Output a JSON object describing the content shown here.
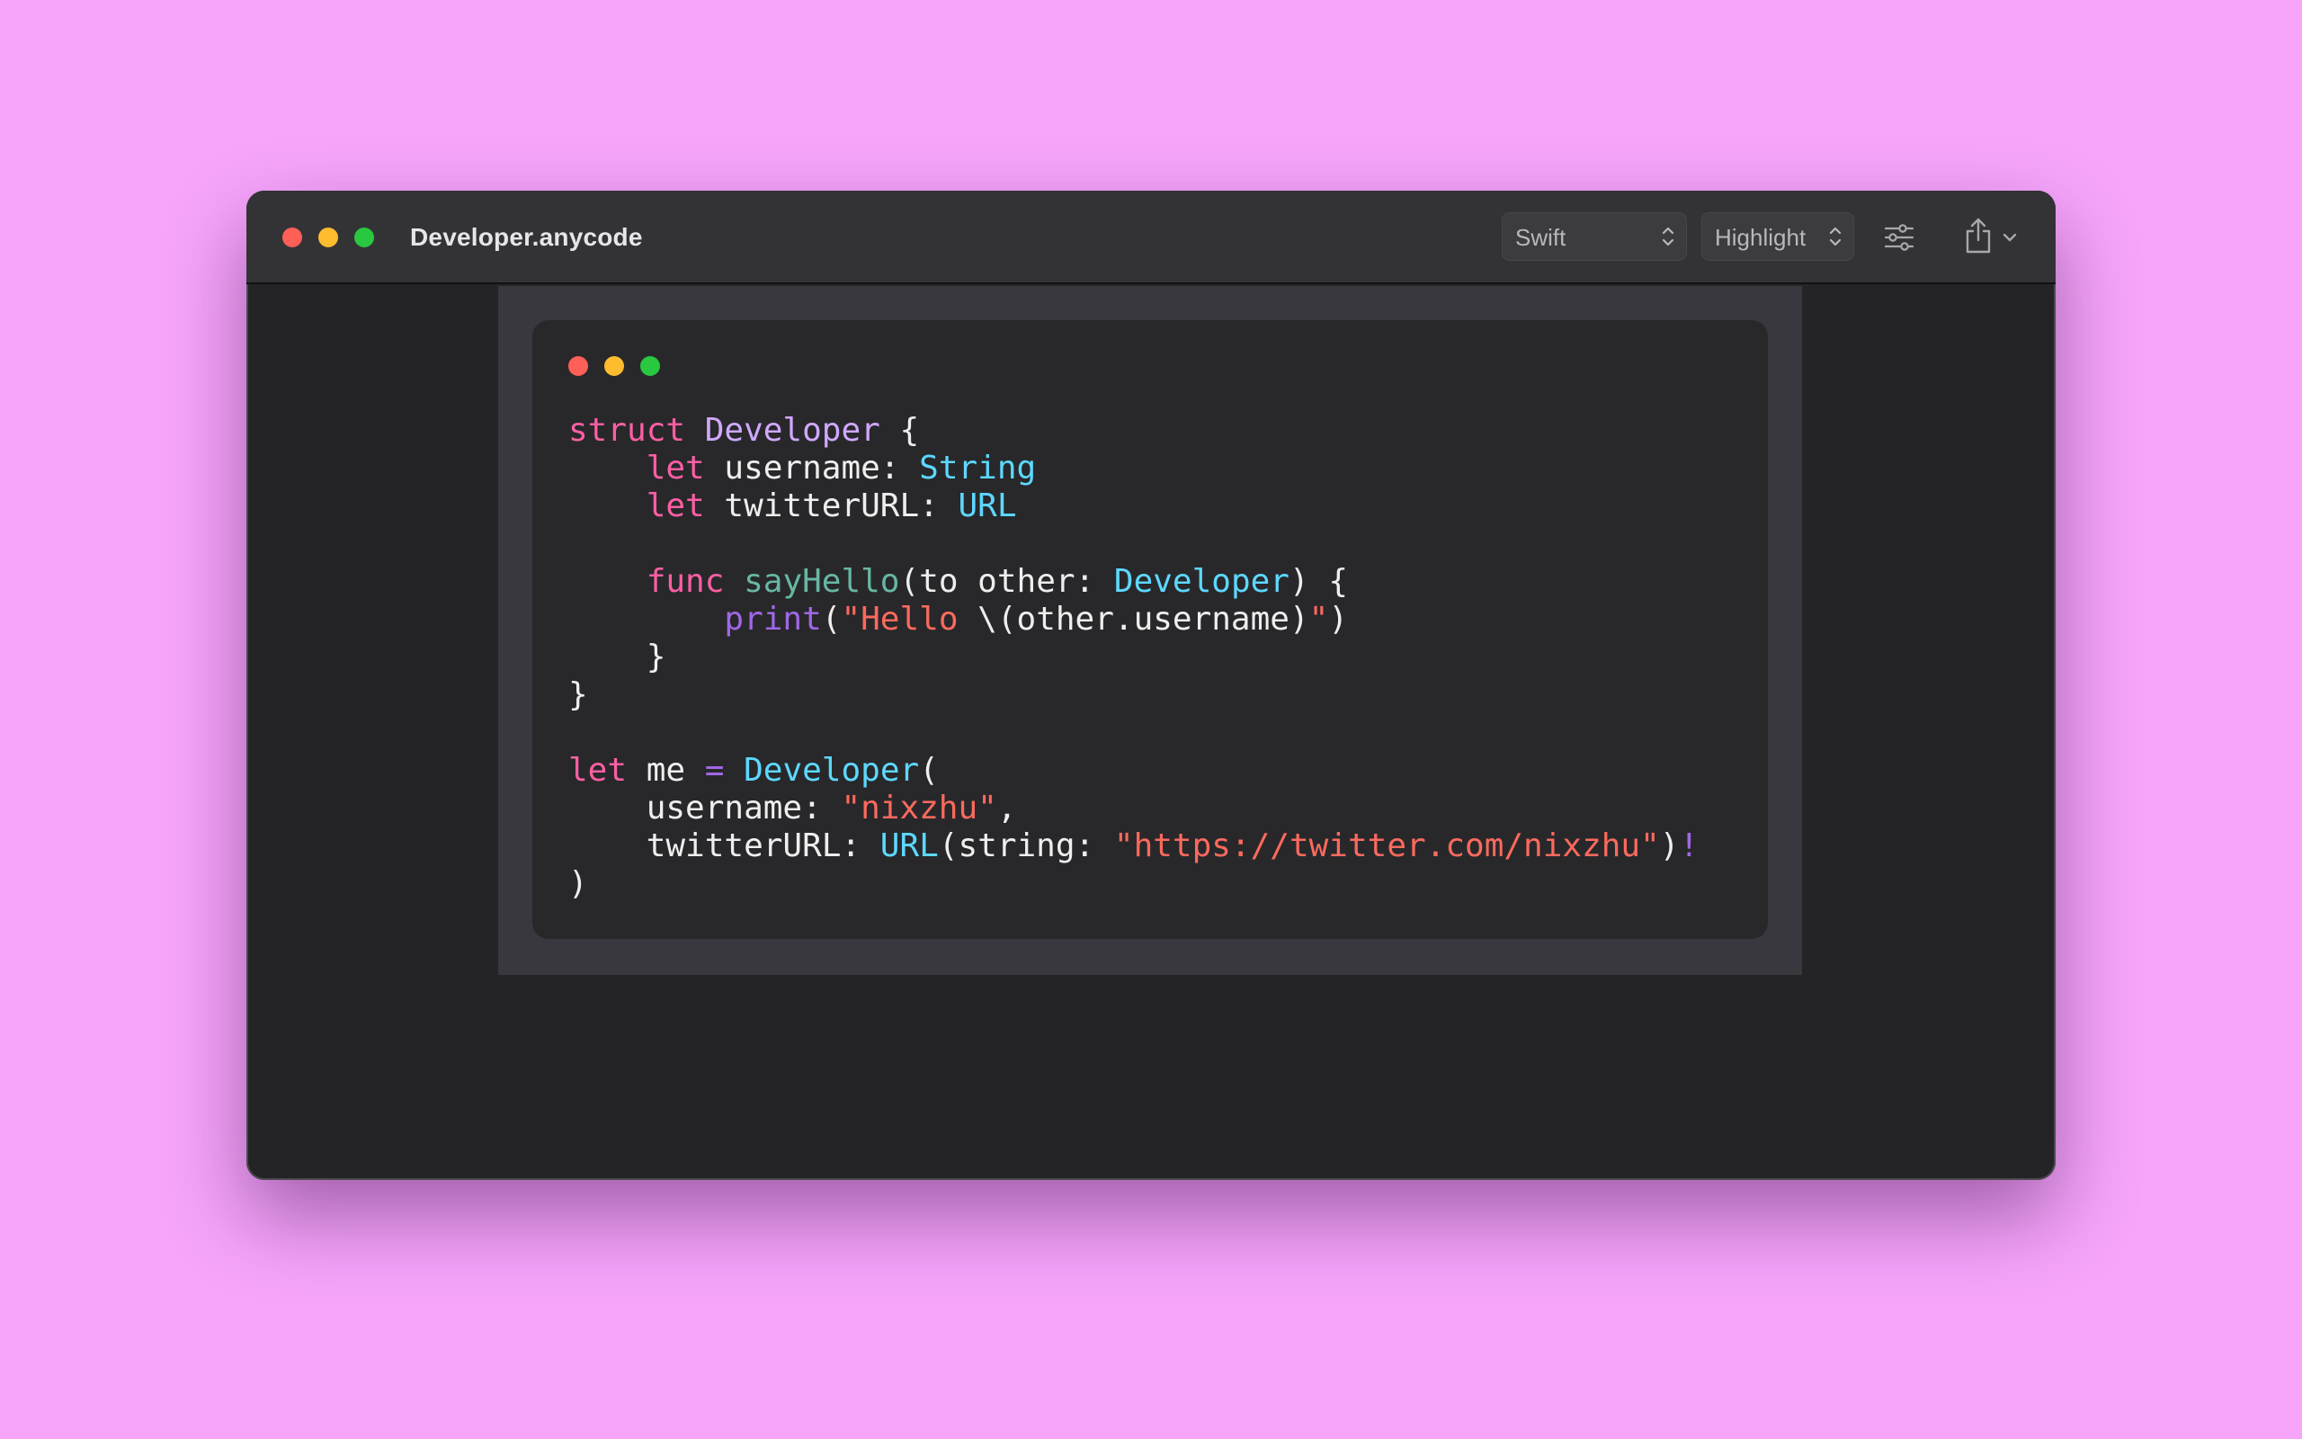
{
  "window": {
    "title": "Developer.anycode",
    "traffic_lights": [
      "#fe5f57",
      "#febc2e",
      "#28c840"
    ]
  },
  "toolbar": {
    "language_select": {
      "value": "Swift"
    },
    "mode_select": {
      "value": "Highlight"
    },
    "settings_icon": "sliders-icon",
    "share_icon": "share-icon",
    "share_menu_icon": "chevron-down-icon"
  },
  "card": {
    "dots": [
      "#fe5f57",
      "#febc2e",
      "#28c840"
    ]
  },
  "code": {
    "language": "Swift",
    "lines": [
      [
        [
          "kw",
          "struct"
        ],
        [
          "p",
          " "
        ],
        [
          "ty",
          "Developer"
        ],
        [
          "p",
          " {"
        ]
      ],
      [
        [
          "p",
          "    "
        ],
        [
          "kw",
          "let"
        ],
        [
          "p",
          " username: "
        ],
        [
          "cl",
          "String"
        ]
      ],
      [
        [
          "p",
          "    "
        ],
        [
          "kw",
          "let"
        ],
        [
          "p",
          " twitterURL: "
        ],
        [
          "cl",
          "URL"
        ]
      ],
      [
        [
          "p",
          ""
        ]
      ],
      [
        [
          "p",
          "    "
        ],
        [
          "kw",
          "func"
        ],
        [
          "p",
          " "
        ],
        [
          "fn",
          "sayHello"
        ],
        [
          "p",
          "(to other: "
        ],
        [
          "cl",
          "Developer"
        ],
        [
          "p",
          ") {"
        ]
      ],
      [
        [
          "p",
          "        "
        ],
        [
          "bi",
          "print"
        ],
        [
          "p",
          "("
        ],
        [
          "st",
          "\"Hello "
        ],
        [
          "p",
          "\\(other.username)"
        ],
        [
          "st",
          "\""
        ],
        [
          "p",
          ")"
        ]
      ],
      [
        [
          "p",
          "    }"
        ]
      ],
      [
        [
          "p",
          "}"
        ]
      ],
      [
        [
          "p",
          ""
        ]
      ],
      [
        [
          "kw",
          "let"
        ],
        [
          "p",
          " me "
        ],
        [
          "bi",
          "="
        ],
        [
          "p",
          " "
        ],
        [
          "cl",
          "Developer"
        ],
        [
          "p",
          "("
        ]
      ],
      [
        [
          "p",
          "    username: "
        ],
        [
          "st",
          "\"nixzhu\""
        ],
        [
          "p",
          ","
        ]
      ],
      [
        [
          "p",
          "    twitterURL: "
        ],
        [
          "cl",
          "URL"
        ],
        [
          "p",
          "(string: "
        ],
        [
          "st",
          "\"https://twitter.com/nixzhu\""
        ],
        [
          "p",
          ")"
        ],
        [
          "bi",
          "!"
        ]
      ],
      [
        [
          "p",
          ")"
        ]
      ]
    ]
  },
  "colors": {
    "background": "#f6a5fb",
    "keyword": "#fc5fa3",
    "type_decl": "#d0a8ff",
    "type_ref": "#5dd8ff",
    "function_decl": "#67b7a4",
    "builtin": "#a167e6",
    "string": "#fc6a5d",
    "plain": "#eeeeee"
  }
}
